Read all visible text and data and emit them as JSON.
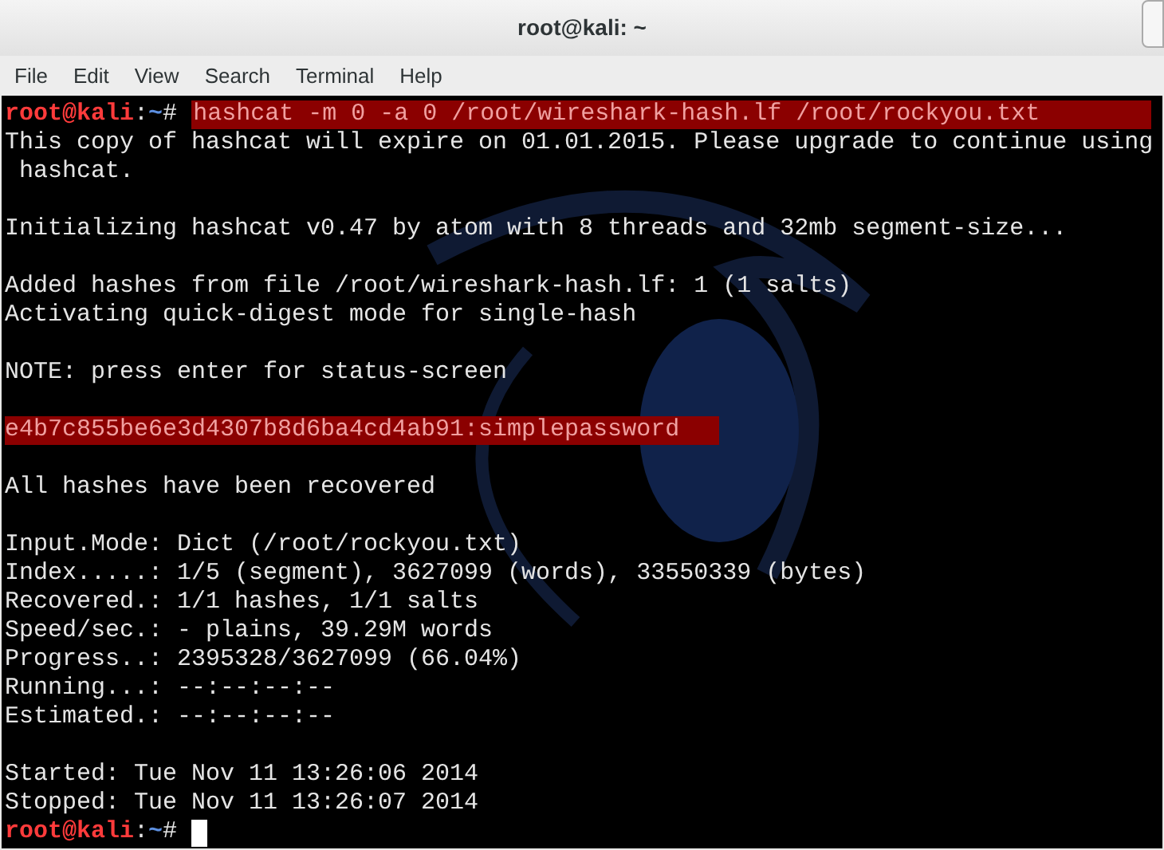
{
  "window": {
    "title": "root@kali: ~"
  },
  "menu": [
    "File",
    "Edit",
    "View",
    "Search",
    "Terminal",
    "Help"
  ],
  "blocks": [
    [
      {
        "kind": "prompt",
        "user": "root@kali",
        "sep": ":",
        "path": "~",
        "symbol": "#",
        "command": "hashcat -m 0 -a 0 /root/wireshark-hash.lf /root/rockyou.txt",
        "highlighted": true
      },
      {
        "kind": "output",
        "text": "This copy of hashcat will expire on 01.01.2015. Please upgrade to continue using",
        "highlighted": false
      },
      {
        "kind": "output",
        "text": " hashcat.",
        "highlighted": false
      }
    ],
    [
      {
        "kind": "output",
        "text": "Initializing hashcat v0.47 by atom with 8 threads and 32mb segment-size...",
        "highlighted": false
      }
    ],
    [
      {
        "kind": "output",
        "text": "Added hashes from file /root/wireshark-hash.lf: 1 (1 salts)",
        "highlighted": false
      },
      {
        "kind": "output",
        "text": "Activating quick-digest mode for single-hash",
        "highlighted": false
      }
    ],
    [
      {
        "kind": "output",
        "text": "NOTE: press enter for status-screen",
        "highlighted": false
      }
    ],
    [
      {
        "kind": "output",
        "text": "e4b7c855be6e3d4307b8d6ba4cd4ab91:simplepassword",
        "highlighted": true
      }
    ],
    [
      {
        "kind": "output",
        "text": "All hashes have been recovered",
        "highlighted": false
      }
    ],
    [
      {
        "kind": "output",
        "text": "Input.Mode: Dict (/root/rockyou.txt)",
        "highlighted": false
      },
      {
        "kind": "output",
        "text": "Index.....: 1/5 (segment), 3627099 (words), 33550339 (bytes)",
        "highlighted": false
      },
      {
        "kind": "output",
        "text": "Recovered.: 1/1 hashes, 1/1 salts",
        "highlighted": false
      },
      {
        "kind": "output",
        "text": "Speed/sec.: - plains, 39.29M words",
        "highlighted": false
      },
      {
        "kind": "output",
        "text": "Progress..: 2395328/3627099 (66.04%)",
        "highlighted": false
      },
      {
        "kind": "output",
        "text": "Running...: --:--:--:--",
        "highlighted": false
      },
      {
        "kind": "output",
        "text": "Estimated.: --:--:--:--",
        "highlighted": false
      }
    ],
    [
      {
        "kind": "output",
        "text": "Started: Tue Nov 11 13:26:06 2014",
        "highlighted": false
      },
      {
        "kind": "output",
        "text": "Stopped: Tue Nov 11 13:26:07 2014",
        "highlighted": false
      },
      {
        "kind": "prompt",
        "user": "root@kali",
        "sep": ":",
        "path": "~",
        "symbol": "#",
        "cursor": true
      }
    ]
  ]
}
